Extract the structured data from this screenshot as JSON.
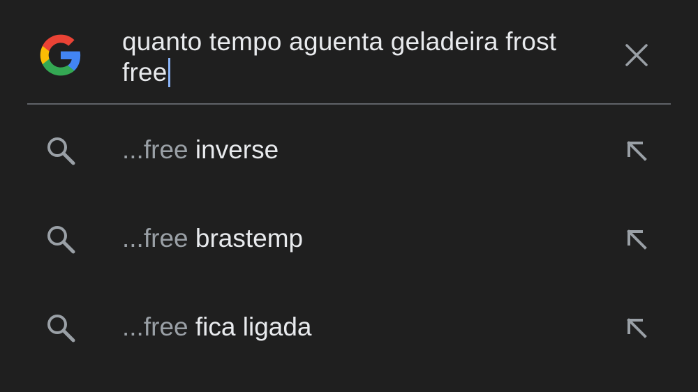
{
  "header": {
    "logo_icon": "google-g-icon",
    "query": "quanto tempo aguenta geladeira frost free",
    "clear_icon": "close-icon"
  },
  "colors": {
    "background": "#1f1f1f",
    "text_primary": "#e8eaed",
    "text_secondary": "#9aa0a6",
    "caret": "#8ab4f8",
    "divider": "#5f6368",
    "icon": "#9aa0a6"
  },
  "suggestions": [
    {
      "prefix": "...free ",
      "completion": "inverse",
      "icon": "search-icon",
      "action_icon": "arrow-up-left-icon"
    },
    {
      "prefix": "...free ",
      "completion": "brastemp",
      "icon": "search-icon",
      "action_icon": "arrow-up-left-icon"
    },
    {
      "prefix": "...free ",
      "completion": "fica ligada",
      "icon": "search-icon",
      "action_icon": "arrow-up-left-icon"
    }
  ]
}
